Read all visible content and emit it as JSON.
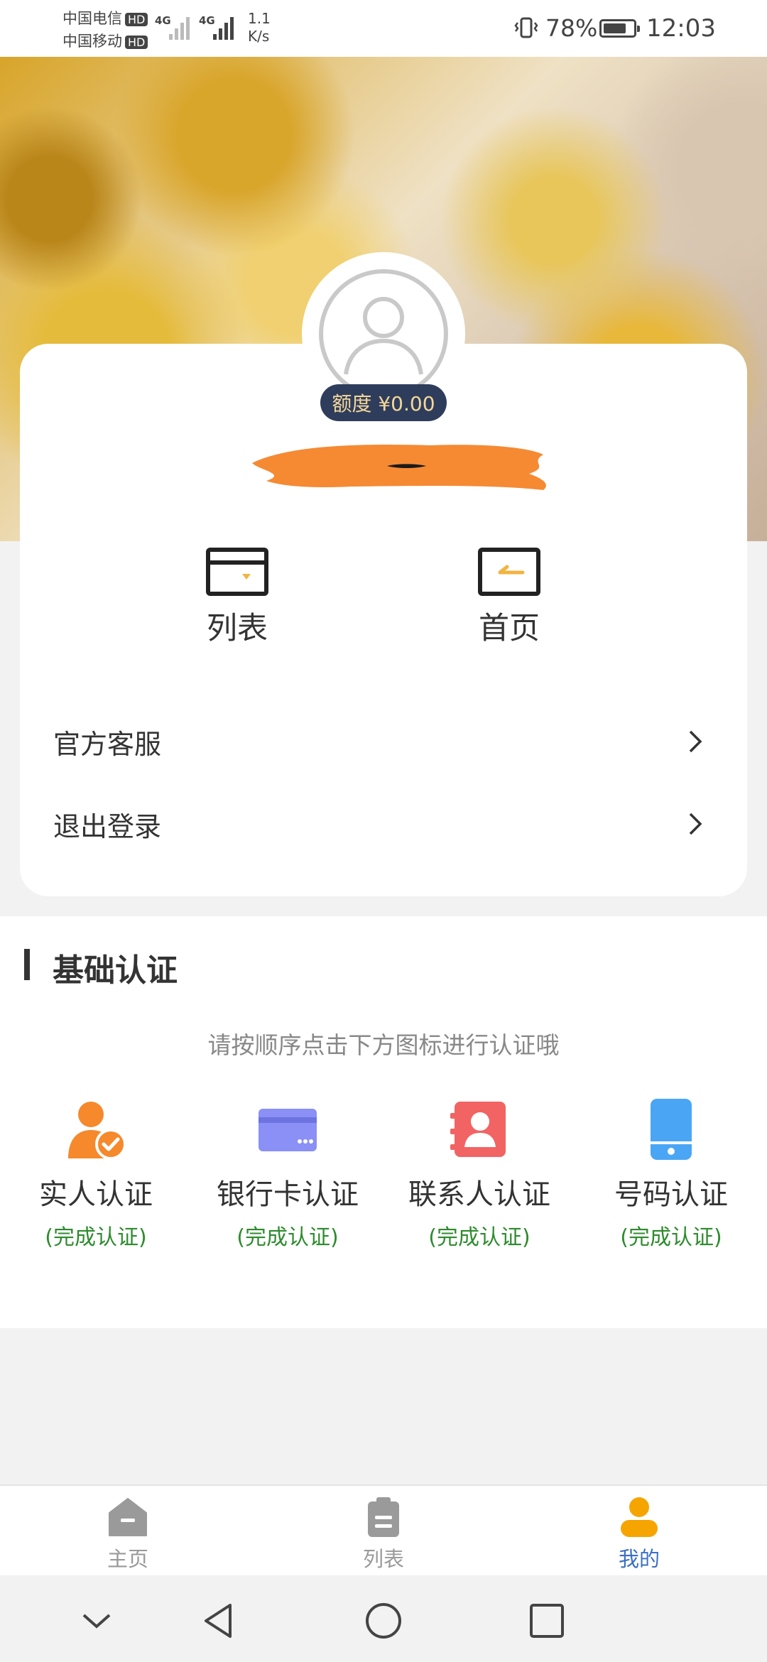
{
  "status_bar": {
    "carrier1": "中国电信",
    "carrier2": "中国移动",
    "hd": "HD",
    "network1": "4G",
    "network2": "4G",
    "speed_value": "1.1",
    "speed_unit": "K/s",
    "battery": "78%",
    "battery_level": 0.78,
    "time": "12:03"
  },
  "profile": {
    "quota": "额度 ¥0.00"
  },
  "quick_actions": [
    {
      "label": "列表"
    },
    {
      "label": "首页"
    }
  ],
  "menu": [
    {
      "label": "官方客服"
    },
    {
      "label": "退出登录"
    }
  ],
  "verification": {
    "title": "基础认证",
    "hint": "请按顺序点击下方图标进行认证哦",
    "items": [
      {
        "name": "实人认证",
        "status": "(完成认证)",
        "icon": "person-check-icon",
        "color": "#f5892b"
      },
      {
        "name": "银行卡认证",
        "status": "(完成认证)",
        "icon": "bank-card-icon",
        "color": "#8a90f5"
      },
      {
        "name": "联系人认证",
        "status": "(完成认证)",
        "icon": "contacts-icon",
        "color": "#f26363"
      },
      {
        "name": "号码认证",
        "status": "(完成认证)",
        "icon": "phone-icon",
        "color": "#4aa6f5"
      }
    ]
  },
  "tabbar": {
    "tabs": [
      {
        "label": "主页",
        "active": false
      },
      {
        "label": "列表",
        "active": false
      },
      {
        "label": "我的",
        "active": true
      }
    ],
    "active_color": "#f6a500",
    "active_label_color": "#3a6fc4",
    "inactive_color": "#9a9a9a"
  }
}
